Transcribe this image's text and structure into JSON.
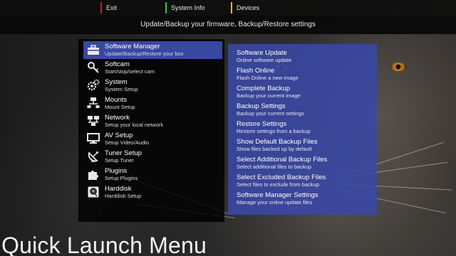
{
  "color_buttons": {
    "red": {
      "label": "Exit",
      "color": "#cc1f1f"
    },
    "green": {
      "label": "System Info",
      "color": "#3fbf3f"
    },
    "yellow": {
      "label": "Devices",
      "color": "#d8c21c"
    }
  },
  "header": {
    "description": "Update/Backup your firmware, Backup/Restore settings"
  },
  "main_menu": {
    "selected_index": 0,
    "items": [
      {
        "title": "Software Manager",
        "subtitle": "Update/Backup/Restore your box",
        "icon": "toolbox-icon"
      },
      {
        "title": "Softcam",
        "subtitle": "Start/stop/select cam",
        "icon": "key-icon"
      },
      {
        "title": "System",
        "subtitle": "System Setup",
        "icon": "gears-icon"
      },
      {
        "title": "Mounts",
        "subtitle": "Mount Setup",
        "icon": "network-tree-icon"
      },
      {
        "title": "Network",
        "subtitle": "Setup your local network",
        "icon": "network-computers-icon"
      },
      {
        "title": "AV Setup",
        "subtitle": "Setup Video/Audio",
        "icon": "monitor-icon"
      },
      {
        "title": "Tuner Setup",
        "subtitle": "Setup Tuner",
        "icon": "satellite-dish-icon"
      },
      {
        "title": "Plugins",
        "subtitle": "Setup Plugins",
        "icon": "puzzle-icon"
      },
      {
        "title": "Harddisk",
        "subtitle": "Harddisk Setup",
        "icon": "harddisk-icon"
      }
    ]
  },
  "sub_menu": {
    "items": [
      {
        "title": "Software Update",
        "subtitle": "Online software update"
      },
      {
        "title": "Flash Online",
        "subtitle": "Flash Online a new image"
      },
      {
        "title": "Complete Backup",
        "subtitle": "Backup your current image"
      },
      {
        "title": "Backup Settings",
        "subtitle": "Backup your current settings"
      },
      {
        "title": "Restore Settings",
        "subtitle": "Restore settings from a backup"
      },
      {
        "title": "Show Default Backup Files",
        "subtitle": "Show files backed up by default"
      },
      {
        "title": "Select Additional Backup Files",
        "subtitle": "Select additional files to backup"
      },
      {
        "title": "Select Excluded Backup Files",
        "subtitle": "Select files to exclude from backup"
      },
      {
        "title": "Software Manager Settings",
        "subtitle": "Manage your online update files"
      }
    ]
  },
  "page_title": "Quick Launch Menu",
  "colors": {
    "selection": "#3948a0",
    "submenu_panel": "#3a48a5"
  }
}
